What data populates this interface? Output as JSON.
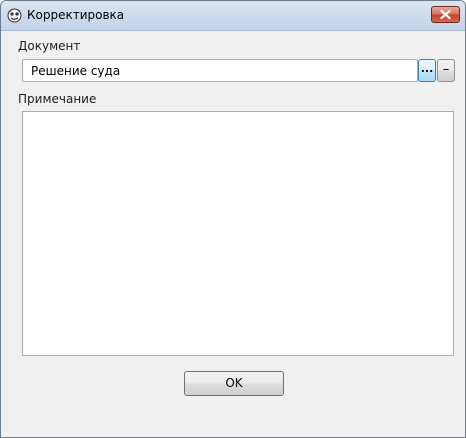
{
  "window": {
    "title": "Корректировка",
    "icon": "app-icon",
    "close_icon": "close-icon"
  },
  "document": {
    "label": "Документ",
    "value": "Решение суда",
    "browse_label": "...",
    "clear_label": "–"
  },
  "note": {
    "label": "Примечание",
    "value": ""
  },
  "footer": {
    "ok_label": "OK"
  },
  "colors": {
    "titlebar": "#cfdcee",
    "close_button": "#c8402a",
    "background": "#f0f0f0",
    "active_button_border": "#3c7fb1"
  }
}
